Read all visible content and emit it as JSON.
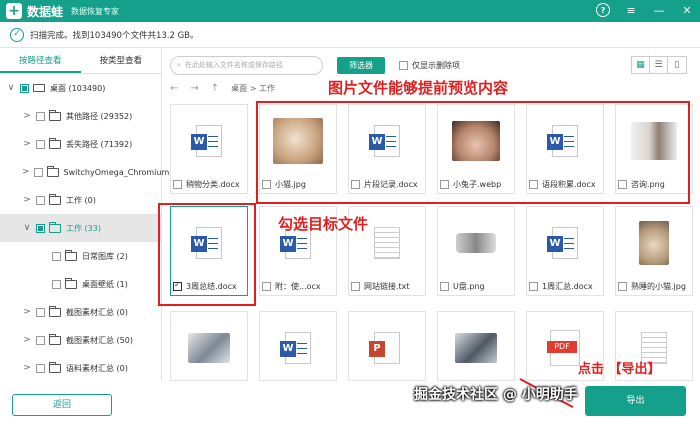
{
  "app": {
    "name": "数据蛙",
    "subtitle": "数据恢复专家",
    "logo_glyph": "+"
  },
  "window_icons": [
    "help-icon",
    "menu-icon",
    "minimize-icon",
    "close-icon"
  ],
  "window_glyphs": {
    "help": "?",
    "menu": "≡",
    "minimize": "—",
    "close": "✕"
  },
  "status": {
    "icon": "✓",
    "text": "扫描完成。找到103490个文件共13.2 GB。"
  },
  "left_tabs": [
    "按路径查看",
    "按类型查看"
  ],
  "tree": [
    {
      "label": "桌面 (103490)",
      "chevron": "∨",
      "level": 0
    },
    {
      "label": "其他路径 (29352)",
      "chevron": ">",
      "level": 1
    },
    {
      "label": "丢失路径 (71392)",
      "chevron": ">",
      "level": 1
    },
    {
      "label": "SwitchyOmega_Chromium",
      "chevron": ">",
      "level": 1
    },
    {
      "label": "工作 (0)",
      "chevron": ">",
      "level": 1
    },
    {
      "label": "工作 (33)",
      "chevron": "∨",
      "level": 1
    },
    {
      "label": "日常图库 (2)",
      "chevron": "",
      "level": 2
    },
    {
      "label": "桌面壁纸 (1)",
      "chevron": "",
      "level": 2
    },
    {
      "label": "截图素材汇总 (0)",
      "chevron": ">",
      "level": 1
    },
    {
      "label": "截图素材汇总 (50)",
      "chevron": ">",
      "level": 1
    },
    {
      "label": "语料素材汇总 (0)",
      "chevron": ">",
      "level": 1
    }
  ],
  "toolbar": {
    "search_placeholder": "在此处输入文件名称或保存路径",
    "filter_label": "筛选器",
    "only_deleted_label": "仅显示删除项"
  },
  "view_glyphs": [
    "▦",
    "☰",
    "▯"
  ],
  "breadcrumb": {
    "back": "←",
    "forward": "→",
    "up": "↑",
    "path": "桌面 > 工作"
  },
  "files": [
    {
      "name": "稍物分类.docx",
      "type": "word",
      "checked": false
    },
    {
      "name": "小猫.jpg",
      "type": "photo-cat",
      "checked": false
    },
    {
      "name": "片段记录.docx",
      "type": "word",
      "checked": false
    },
    {
      "name": "小兔子.webp",
      "type": "photo-rabbit",
      "checked": false
    },
    {
      "name": "语段积累.docx",
      "type": "word",
      "checked": false
    },
    {
      "name": "咨询.png",
      "type": "photo-office",
      "checked": false
    },
    {
      "name": "3周总结.docx",
      "type": "word",
      "checked": true
    },
    {
      "name": "附：使...ocx",
      "type": "word",
      "checked": false
    },
    {
      "name": "网站链接.txt",
      "type": "txt",
      "checked": false
    },
    {
      "name": "U盘.png",
      "type": "photo-usb",
      "checked": false
    },
    {
      "name": "1周汇总.docx",
      "type": "word",
      "checked": false
    },
    {
      "name": "熟睡的小猫.jpg",
      "type": "photo-sleepcat",
      "checked": false
    },
    {
      "name": "",
      "type": "photo-laptop",
      "checked": false
    },
    {
      "name": "",
      "type": "word",
      "checked": false
    },
    {
      "name": "",
      "type": "ppt",
      "checked": false
    },
    {
      "name": "",
      "type": "photo-desk",
      "checked": false
    },
    {
      "name": "",
      "type": "pdf",
      "checked": false
    },
    {
      "name": "",
      "type": "txt",
      "checked": false
    }
  ],
  "annotations": {
    "preview": "图片文件能够提前预览内容",
    "select": "勾选目标文件",
    "export": "点击 【导出】"
  },
  "buttons": {
    "back": "返回",
    "export": "导出"
  },
  "watermark": "掘金技术社区 @ 小明助手",
  "colors": {
    "accent": "#14a08a",
    "annotation": "#e02020",
    "word": "#2b5aab",
    "ppt": "#c6472d",
    "pdf": "#e03b2f"
  }
}
